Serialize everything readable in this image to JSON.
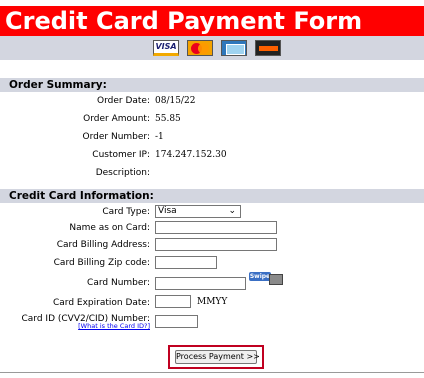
{
  "header": {
    "title": "Credit Card Payment Form"
  },
  "card_logos": [
    "visa-icon",
    "mastercard-icon",
    "amex-icon",
    "discover-icon"
  ],
  "visa_logo_text": "VISA",
  "order_summary": {
    "title": "Order Summary:",
    "rows": [
      {
        "label": "Order Date:",
        "value": "08/15/22"
      },
      {
        "label": "Order Amount:",
        "value": "55.85"
      },
      {
        "label": "Order Number:",
        "value": "-1"
      },
      {
        "label": "Customer IP:",
        "value": "174.247.152.30"
      },
      {
        "label": "Description:",
        "value": ""
      }
    ]
  },
  "card_info": {
    "title": "Credit Card Information:",
    "card_type": {
      "label": "Card Type:",
      "selected": "Visa"
    },
    "name": {
      "label": "Name as on Card:",
      "value": ""
    },
    "address": {
      "label": "Card Billing Address:",
      "value": ""
    },
    "zip": {
      "label": "Card Billing Zip code:",
      "value": ""
    },
    "number": {
      "label": "Card Number:",
      "value": ""
    },
    "swipe_label": "Swipe",
    "expiration": {
      "label": "Card Expiration Date:",
      "value": "",
      "format_hint": "MMYY"
    },
    "cvv": {
      "label": "Card ID (CVV2/CID) Number:",
      "value": "",
      "help_link": "[What is the Card ID?]"
    }
  },
  "submit": {
    "label": "Process Payment >>"
  },
  "colors": {
    "header_bg": "#ff0000",
    "section_bg": "#d3d6e0",
    "highlight_border": "#c00020"
  }
}
